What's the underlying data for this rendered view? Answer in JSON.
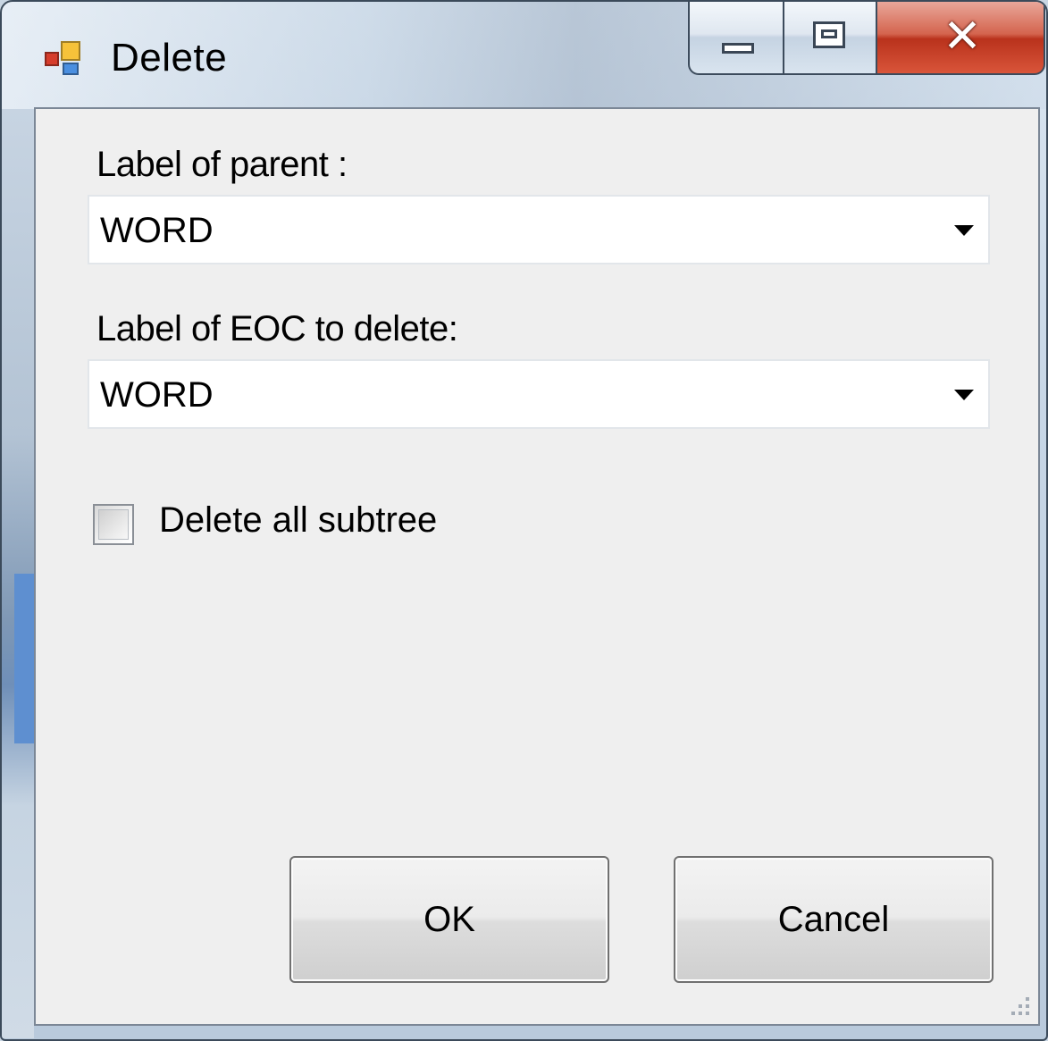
{
  "window": {
    "title": "Delete"
  },
  "form": {
    "parent_label": "Label of parent :",
    "parent_value": "WORD",
    "eoc_label": "Label of EOC to delete:",
    "eoc_value": "WORD",
    "subtree_checkbox_label": "Delete all subtree",
    "subtree_checked": false
  },
  "buttons": {
    "ok": "OK",
    "cancel": "Cancel"
  },
  "colors": {
    "client_background": "#efefef",
    "close_button": "#c9442b"
  }
}
